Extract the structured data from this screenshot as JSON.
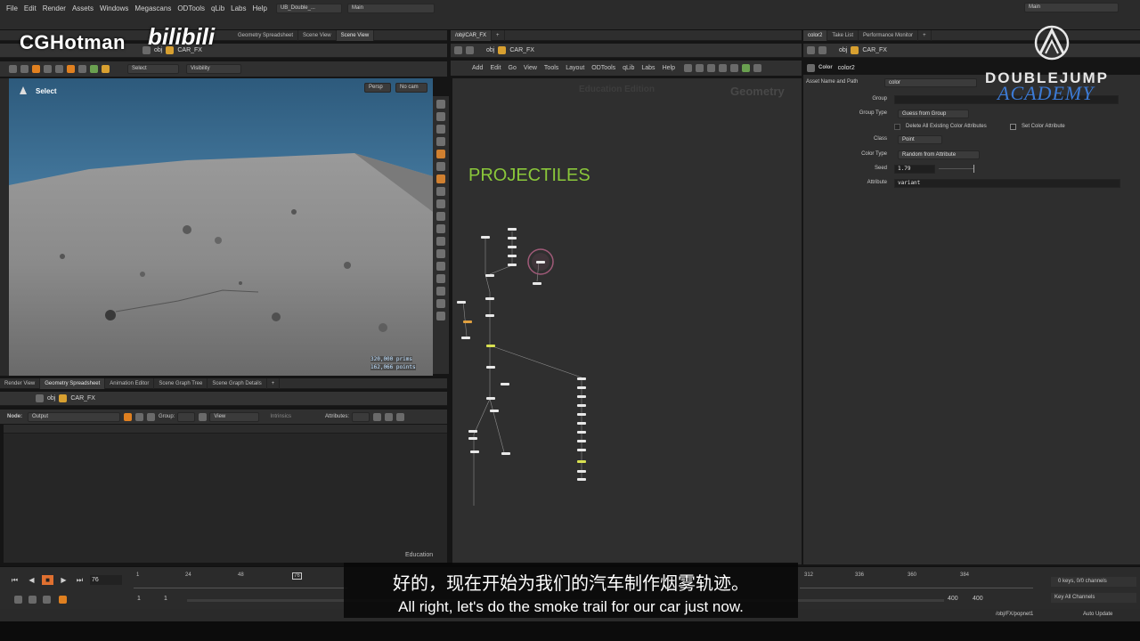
{
  "menubar": {
    "items": [
      "File",
      "Edit",
      "Render",
      "Assets",
      "Windows",
      "Megascans",
      "ODTools",
      "qLib",
      "Labs",
      "Help"
    ],
    "desktop_tab": "UB_Double_...",
    "desktop_combo": "Main",
    "right_combo": "Main"
  },
  "left_pane": {
    "tabs": [
      "Geometry Spreadsheet",
      "Scene View",
      "Scene View"
    ],
    "path": [
      "obj",
      "CAR_FX"
    ],
    "toolbar": {
      "select_combo": "Select",
      "visibility_combo": "Visibility"
    },
    "viewport": {
      "select_label": "Select",
      "persp_btn": "Persp",
      "cam_btn": "No cam",
      "prims_stat": "320,000  prims",
      "points_stat": "162,066 points"
    }
  },
  "bottom_left_pane": {
    "tabs": [
      "Render View",
      "Geometry Spreadsheet",
      "Animation Editor",
      "Scene Graph Tree",
      "Scene Graph Details"
    ],
    "path": [
      "obj",
      "CAR_FX"
    ],
    "node_label": "Node:",
    "node_value": "Output",
    "group_label": "Group:",
    "view_combo": "View",
    "intrinsics": "Intrinsics",
    "attributes_label": "Attributes:",
    "education": "Education"
  },
  "network_pane": {
    "tab": "/obj/CAR_FX",
    "path": [
      "obj",
      "CAR_FX"
    ],
    "menu": [
      "Add",
      "Edit",
      "Go",
      "View",
      "Tools",
      "Layout",
      "ODTools",
      "qLib",
      "Labs",
      "Help"
    ],
    "edition_watermark": "Education Edition",
    "context_label": "Geometry",
    "sticky_title": "PROJECTILES",
    "sticky_color": "#8ac73a"
  },
  "parm_pane": {
    "tabs": [
      "color2",
      "Take List",
      "Performance Monitor"
    ],
    "path": [
      "obj",
      "CAR_FX"
    ],
    "node_type": "Color",
    "node_name": "color2",
    "asset_label": "Asset Name and Path",
    "asset_value": "color",
    "params": {
      "group_label": "Group",
      "group_type_label": "Group Type",
      "group_type_value": "Guess from Group",
      "delete_label": "Delete All Existing Color Attributes",
      "set_color_label": "Set Color Attribute",
      "class_label": "Class",
      "class_value": "Point",
      "color_type_label": "Color Type",
      "color_type_value": "Random from Attribute",
      "seed_label": "Seed",
      "seed_value": "1.79",
      "attribute_label": "Attribute",
      "attribute_value": "variant"
    }
  },
  "timeline": {
    "current_frame": "76",
    "ticks": [
      "1",
      "24",
      "48",
      "76",
      "312",
      "336",
      "360",
      "384"
    ],
    "range_start": "1",
    "range_start2": "1",
    "range_end": "400",
    "range_end2": "400",
    "keys_info": "0 keys, 0/0 channels",
    "key_all": "Key All Channels"
  },
  "status": {
    "path": "/obj/FX/popnet1",
    "auto_update": "Auto Update"
  },
  "subtitle": {
    "cn": "好的，现在开始为我们的汽车制作烟雾轨迹。",
    "en": "All right, let's do the smoke trail for our car just now."
  },
  "watermarks": {
    "cghotman": "CGHotman",
    "bilibili": "bilibili",
    "doublejump": "DOUBLEJUMP",
    "academy": "ACADEMY"
  }
}
